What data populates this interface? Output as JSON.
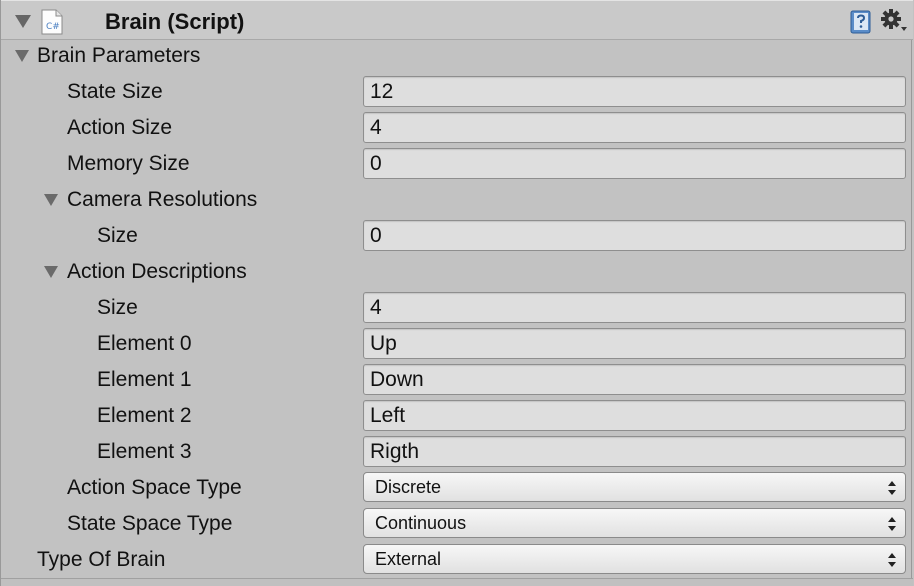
{
  "component": {
    "title": "Brain (Script)",
    "script_icon": "csharp-script-icon",
    "script_icon_text": "C#",
    "help_icon": "help-book-icon",
    "gear_icon": "gear-icon"
  },
  "brain_parameters": {
    "label": "Brain Parameters",
    "state_size": {
      "label": "State Size",
      "value": "12"
    },
    "action_size": {
      "label": "Action Size",
      "value": "4"
    },
    "memory_size": {
      "label": "Memory Size",
      "value": "0"
    },
    "camera_resolutions": {
      "label": "Camera Resolutions",
      "size": {
        "label": "Size",
        "value": "0"
      }
    },
    "action_descriptions": {
      "label": "Action Descriptions",
      "size": {
        "label": "Size",
        "value": "4"
      },
      "elements": [
        {
          "label": "Element 0",
          "value": "Up"
        },
        {
          "label": "Element 1",
          "value": "Down"
        },
        {
          "label": "Element 2",
          "value": "Left"
        },
        {
          "label": "Element 3",
          "value": "Rigth"
        }
      ]
    },
    "action_space_type": {
      "label": "Action Space Type",
      "value": "Discrete"
    },
    "state_space_type": {
      "label": "State Space Type",
      "value": "Continuous"
    }
  },
  "type_of_brain": {
    "label": "Type Of Brain",
    "value": "External"
  }
}
